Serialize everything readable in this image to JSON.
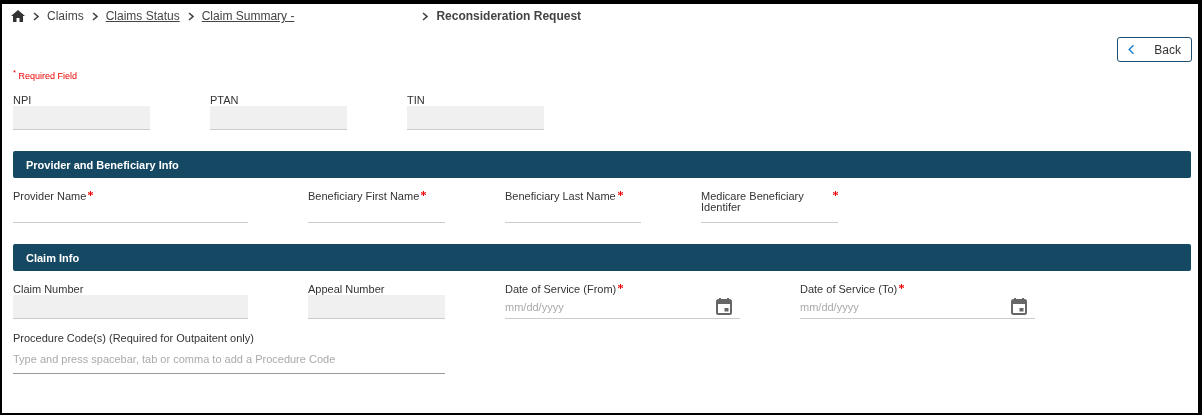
{
  "breadcrumb": [
    {
      "label": "Claims",
      "link": false
    },
    {
      "label": "Claims Status",
      "link": true
    },
    {
      "label": "Claim Summary -",
      "link": true
    },
    {
      "label": "Reconsideration Request",
      "link": false,
      "current": true
    }
  ],
  "back_button": {
    "label": "Back"
  },
  "required_note": "$^{*}$ Required Field",
  "top_fields": [
    {
      "label": "NPI",
      "kind": "filled",
      "required": false
    },
    {
      "label": "PTAN",
      "kind": "filled",
      "required": false
    },
    {
      "label": "TIN",
      "kind": "filled",
      "required": false
    }
  ],
  "sections": [
    {
      "title": "Provider and Beneficiary Info",
      "fields": [
        {
          "label": "Provider Name",
          "kind": "underline",
          "required": true
        },
        {
          "label": "Beneficiary First Name",
          "kind": "underline",
          "required": true
        },
        {
          "label": "Beneficiary Last Name",
          "kind": "underline",
          "required": true
        },
        {
          "label": "Medicare Beneficiary Identifer",
          "kind": "underline",
          "required": true
        }
      ]
    },
    {
      "title": "Claim Info",
      "fields": [
        {
          "label": "Claim Number",
          "kind": "filled",
          "required": false
        },
        {
          "label": "Appeal Number",
          "kind": "filled",
          "required": false
        },
        {
          "label": "Date of Service (From)",
          "kind": "date",
          "required": true,
          "placeholder": "mm/dd/yyyy"
        },
        {
          "label": "Date of Service (To)",
          "kind": "date",
          "required": true,
          "placeholder": "mm/dd/yyyy"
        },
        {
          "label": "Procedure Code(s) (Required for Outpaitent only)",
          "kind": "underline",
          "required": false,
          "placeholder": "Type and press spacebar, tab or comma to add a Procedure Code"
        }
      ]
    }
  ]
}
